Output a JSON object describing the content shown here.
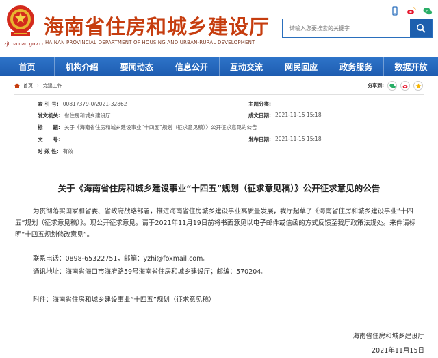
{
  "header": {
    "site_title": "海南省住房和城乡建设厅",
    "site_subtitle": "HAINAN PROVINCIAL DEPARTMENT OF HOUSING AND URBAN-RURAL DEVELOPMENT",
    "site_url": "zjt.hainan.gov.cn",
    "search_placeholder": "请输入您要搜索的关键字"
  },
  "nav": {
    "items": [
      "首页",
      "机构介绍",
      "要闻动态",
      "信息公开",
      "互动交流",
      "网民回应",
      "政务服务",
      "数据开放"
    ]
  },
  "breadcrumb": {
    "home": "首页",
    "section": "党建工作"
  },
  "share": {
    "label": "分享到:"
  },
  "info": {
    "index_label": "索 引 号:",
    "index_value": "00817379-0/2021-32862",
    "topic_label": "主题分类:",
    "topic_value": "",
    "issuer_label": "发文机关:",
    "issuer_value": "省住房和城乡建设厅",
    "created_label": "成文日期:",
    "created_value": "2021-11-15 15:18",
    "title_label": "标　　题:",
    "title_value": "关于《海南省住房和城乡建设事业“十四五”规划（征求意见稿）》公开征求意见的公告",
    "docno_label": "文　　号:",
    "docno_value": "",
    "published_label": "发布日期:",
    "published_value": "2021-11-15 15:18",
    "validity_label": "时 效 性:",
    "validity_value": "有效"
  },
  "article": {
    "title": "关于《海南省住房和城乡建设事业“十四五”规划（征求意见稿）》公开征求意见的公告",
    "paragraph1": "为贯彻落实国家和省委、省政府战略部署，推进海南省住房城乡建设事业高质量发展，我厅起草了《海南省住房和城乡建设事业“十四五”规划（征求意见稿）》。现公开征求意见。请于2021年11月19日前将书面意见以电子邮件或信函的方式反馈至我厅政策法规处。来件请标明“十四五规划修改意见”。",
    "contact": "联系电话：0898-65322751，邮箱：yzhi@foxmail.com。",
    "address": "通讯地址：海南省海口市海府路59号海南省住房和城乡建设厅；邮编：570204。",
    "attachment": "附件：海南省住房和城乡建设事业“十四五”规划（征求意见稿）",
    "sign_org": "海南省住房和城乡建设厅",
    "sign_date": "2021年11月15日"
  },
  "colors": {
    "brand_red": "#c63d0f",
    "nav_blue": "#1e5cb0"
  }
}
